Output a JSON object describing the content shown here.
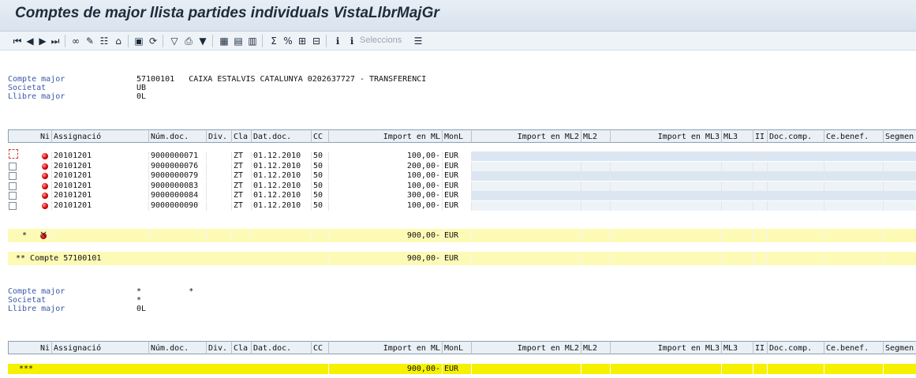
{
  "title": "Comptes de major llista partides individuals VistaLlbrMajGr",
  "toolbar": {
    "selections_label": "Seleccions"
  },
  "header1": {
    "account_label": "Compte major",
    "account_value": "57100101   CAIXA ESTALVIS CATALUNYA 0202637727 - TRANSFERENCI",
    "company_label": "Societat",
    "company_value": "UB",
    "ledger_label": "Llibre major",
    "ledger_value": "0L"
  },
  "columns": [
    "Ni",
    "Assignació",
    "Núm.doc.",
    "Div.",
    "Cla",
    "Dat.doc.",
    "CC",
    "Import en ML",
    "MonL",
    "Import en ML2",
    "ML2",
    "Import en ML3",
    "ML3",
    "II",
    "Doc.comp.",
    "Ce.benef.",
    "Segmen"
  ],
  "rows": [
    {
      "assign": "20101201",
      "doc": "9000000071",
      "cla": "ZT",
      "date": "01.12.2010",
      "cc": "50",
      "amount": "100,00-",
      "cur": "EUR"
    },
    {
      "assign": "20101201",
      "doc": "9000000076",
      "cla": "ZT",
      "date": "01.12.2010",
      "cc": "50",
      "amount": "200,00-",
      "cur": "EUR"
    },
    {
      "assign": "20101201",
      "doc": "9000000079",
      "cla": "ZT",
      "date": "01.12.2010",
      "cc": "50",
      "amount": "100,00-",
      "cur": "EUR"
    },
    {
      "assign": "20101201",
      "doc": "9000000083",
      "cla": "ZT",
      "date": "01.12.2010",
      "cc": "50",
      "amount": "100,00-",
      "cur": "EUR"
    },
    {
      "assign": "20101201",
      "doc": "9000000084",
      "cla": "ZT",
      "date": "01.12.2010",
      "cc": "50",
      "amount": "300,00-",
      "cur": "EUR"
    },
    {
      "assign": "20101201",
      "doc": "9000000090",
      "cla": "ZT",
      "date": "01.12.2010",
      "cc": "50",
      "amount": "100,00-",
      "cur": "EUR"
    }
  ],
  "subtotal": {
    "marker": "*",
    "amount": "900,00-",
    "cur": "EUR"
  },
  "account_total": {
    "label": "** Compte 57100101",
    "amount": "900,00-",
    "cur": "EUR"
  },
  "header2": {
    "account_label": "Compte major",
    "account_value": "*          *",
    "company_label": "Societat",
    "company_value": "*",
    "ledger_label": "Llibre major",
    "ledger_value": "0L"
  },
  "grand_total": {
    "label": "***",
    "amount": "900,00-",
    "cur": "EUR"
  },
  "colors": {
    "subtotal_bg": "#fdfab6",
    "total_bg": "#f6f100",
    "header_bg": "#eaf0f6",
    "accent_text": "#3a58a8"
  }
}
